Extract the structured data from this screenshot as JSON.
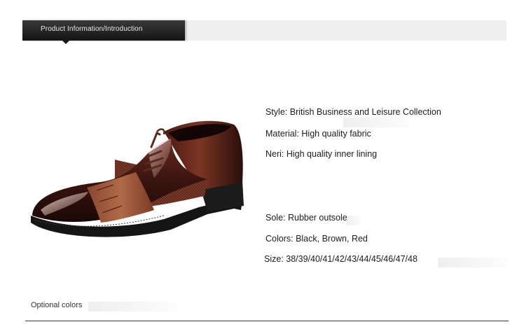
{
  "section_header": {
    "title": "Product Information/Introduction"
  },
  "product": {
    "image_icon": "brown-patent-leather-oxford-shoe",
    "colors": {
      "brown": "#7a3a22",
      "dark_brown": "#3a1410",
      "sole": "#1a1a1a"
    }
  },
  "specs": {
    "style": "Style: British Business and Leisure Collection",
    "material": "Material: High quality fabric",
    "lining": "Neri: High quality inner lining",
    "sole": "Sole: Rubber outsole",
    "colors": "Colors: Black, Brown, Red",
    "size": "Size: 38/39/40/41/42/43/44/45/46/47/48"
  },
  "footer": {
    "optional_colors_label": "Optional colors"
  }
}
